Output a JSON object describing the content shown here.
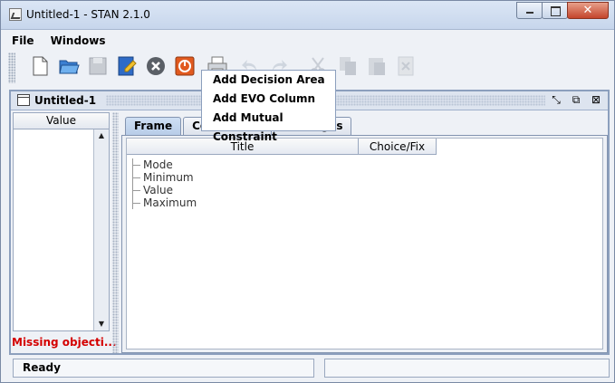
{
  "window": {
    "title": "Untitled-1 - STAN 2.1.0"
  },
  "menu": {
    "items": [
      "File",
      "Windows"
    ]
  },
  "toolbar": {
    "buttons": [
      {
        "name": "new-document-icon",
        "enabled": true
      },
      {
        "name": "open-folder-icon",
        "enabled": true
      },
      {
        "name": "save-icon",
        "enabled": false
      },
      {
        "name": "edit-notes-icon",
        "enabled": true
      },
      {
        "name": "close-circle-icon",
        "enabled": true
      },
      {
        "name": "stop-power-icon",
        "enabled": true
      },
      {
        "name": "print-icon",
        "enabled": true
      },
      {
        "name": "undo-icon",
        "enabled": false
      },
      {
        "name": "redo-icon",
        "enabled": false
      },
      {
        "name": "cut-icon",
        "enabled": false
      },
      {
        "name": "copy-icon",
        "enabled": false
      },
      {
        "name": "paste-icon",
        "enabled": false
      },
      {
        "name": "delete-icon",
        "enabled": false
      }
    ]
  },
  "internal_frame": {
    "title": "Untitled-1",
    "left_panel": {
      "header": "Value",
      "status_error": "Missing objecti..."
    },
    "tabs": [
      {
        "label": "Frame",
        "active": true
      },
      {
        "label": "Constraints",
        "active": false
      },
      {
        "label": "Messages",
        "active": false
      }
    ],
    "table": {
      "columns": [
        "Title",
        "Choice/Fix"
      ]
    },
    "tree_items": [
      "Mode",
      "Minimum",
      "Value",
      "Maximum"
    ],
    "context_menu": [
      "Add Decision Area",
      "Add EVO Column",
      "Add Mutual Constraint"
    ]
  },
  "status": {
    "text": "Ready"
  },
  "colors": {
    "error": "#d40000",
    "tab_active": "#b8cde8",
    "close_button": "#c4452c"
  }
}
